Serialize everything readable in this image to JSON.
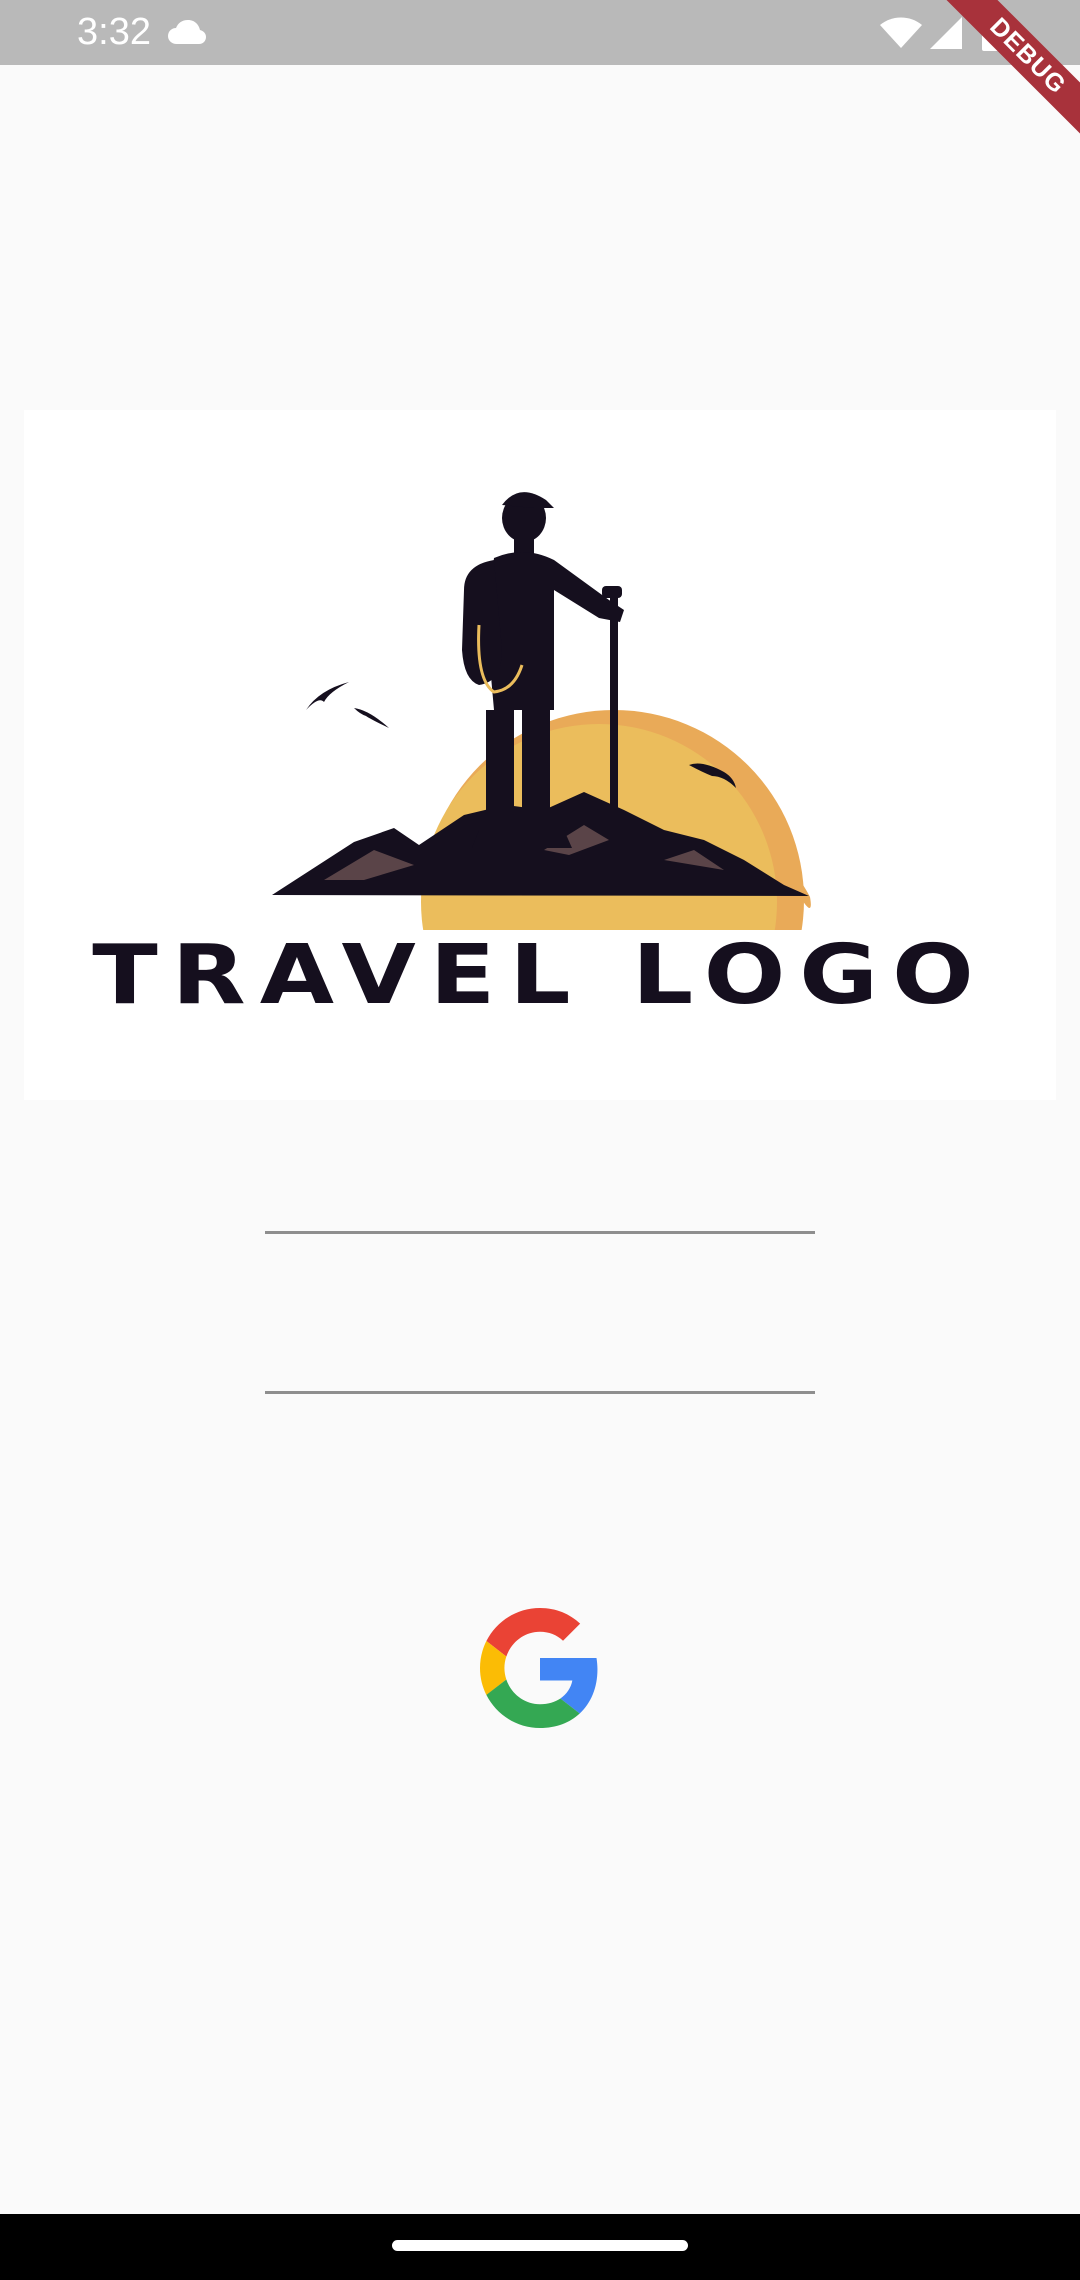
{
  "status_bar": {
    "time": "3:32",
    "icons": [
      "cloud-icon",
      "wifi-icon",
      "signal-icon",
      "battery-icon"
    ]
  },
  "debug_banner": {
    "label": "DEBUG"
  },
  "logo": {
    "text": "TRAVEL LOGO",
    "colors": {
      "silhouette": "#150f1e",
      "sun": "#ebbd5c",
      "sun_rim": "#e9aa58"
    }
  },
  "form": {
    "field_1_value": "",
    "field_2_value": ""
  },
  "google_sign_in": {
    "icon": "google-icon",
    "colors": {
      "red": "#ea4335",
      "yellow": "#fbbc05",
      "green": "#34a853",
      "blue": "#4285f4"
    }
  }
}
